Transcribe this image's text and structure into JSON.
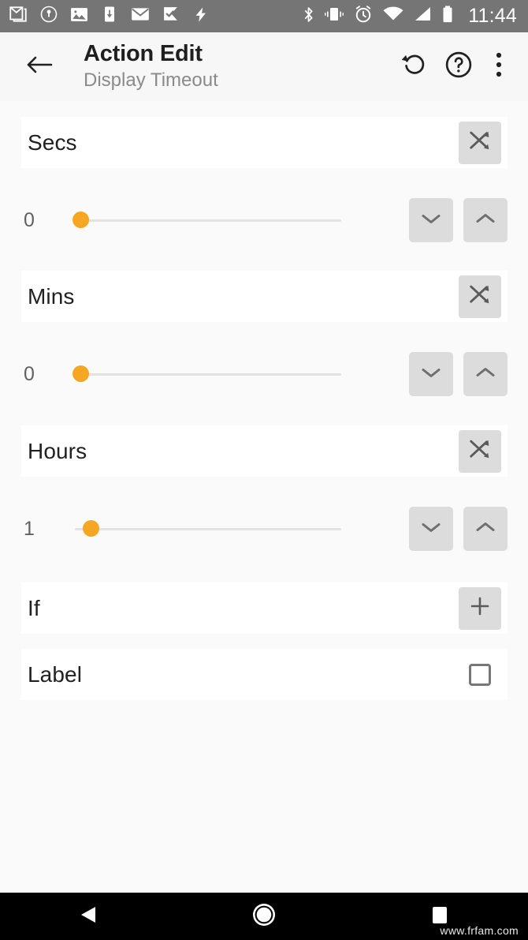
{
  "status_bar": {
    "background_color": "#757575",
    "time": "11:44",
    "left_icons": [
      {
        "name": "gmail-icon"
      },
      {
        "name": "shield-security-icon"
      },
      {
        "name": "gallery-image-icon"
      },
      {
        "name": "download-to-device-icon"
      },
      {
        "name": "email-envelope-icon"
      },
      {
        "name": "checkmark-flag-icon"
      },
      {
        "name": "lightning-bolt-icon"
      }
    ],
    "right_icons": [
      {
        "name": "bluetooth-icon"
      },
      {
        "name": "vibrate-icon"
      },
      {
        "name": "alarm-clock-icon"
      },
      {
        "name": "wifi-icon"
      },
      {
        "name": "cellular-signal-icon"
      },
      {
        "name": "battery-icon"
      }
    ]
  },
  "app_bar": {
    "background_color": "#f7f7f7",
    "title": "Action Edit",
    "subtitle": "Display Timeout",
    "back_icon": "arrow-left-icon",
    "actions": [
      {
        "name": "undo-reset-button",
        "icon": "undo-rotate-left-icon"
      },
      {
        "name": "help-button",
        "icon": "question-mark-circle-icon"
      },
      {
        "name": "overflow-menu-button",
        "icon": "three-dots-vertical-icon"
      }
    ]
  },
  "theme": {
    "accent_color": "#f5a623",
    "card_background": "#ffffff",
    "page_background": "#fafafa",
    "button_background": "#dcdcdc",
    "label_text_color": "#212121",
    "value_text_color": "#616161"
  },
  "fields": [
    {
      "key": "secs",
      "label": "Secs",
      "action_icon": "shuffle-variable-icon",
      "value": "0",
      "slider": {
        "min": 0,
        "max": 59,
        "value": 0,
        "fill_ratio": 0.0
      },
      "stepper": {
        "decrement_icon": "chevron-down-icon",
        "increment_icon": "chevron-up-icon"
      }
    },
    {
      "key": "mins",
      "label": "Mins",
      "action_icon": "shuffle-variable-icon",
      "value": "0",
      "slider": {
        "min": 0,
        "max": 59,
        "value": 0,
        "fill_ratio": 0.0
      },
      "stepper": {
        "decrement_icon": "chevron-down-icon",
        "increment_icon": "chevron-up-icon"
      }
    },
    {
      "key": "hours",
      "label": "Hours",
      "action_icon": "shuffle-variable-icon",
      "value": "1",
      "slider": {
        "min": 0,
        "max": 24,
        "value": 1,
        "fill_ratio": 0.042
      },
      "stepper": {
        "decrement_icon": "chevron-down-icon",
        "increment_icon": "chevron-up-icon"
      }
    }
  ],
  "if_row": {
    "label": "If",
    "action_icon": "plus-icon"
  },
  "label_row": {
    "label": "Label",
    "checkbox_checked": false,
    "checkbox_icon": "checkbox-unchecked-icon"
  },
  "nav_bar": {
    "background_color": "#000000",
    "back_icon": "triangle-back-icon",
    "home_icon": "circle-home-icon",
    "recents_icon": "square-recents-icon"
  },
  "watermark": "www.frfam.com"
}
